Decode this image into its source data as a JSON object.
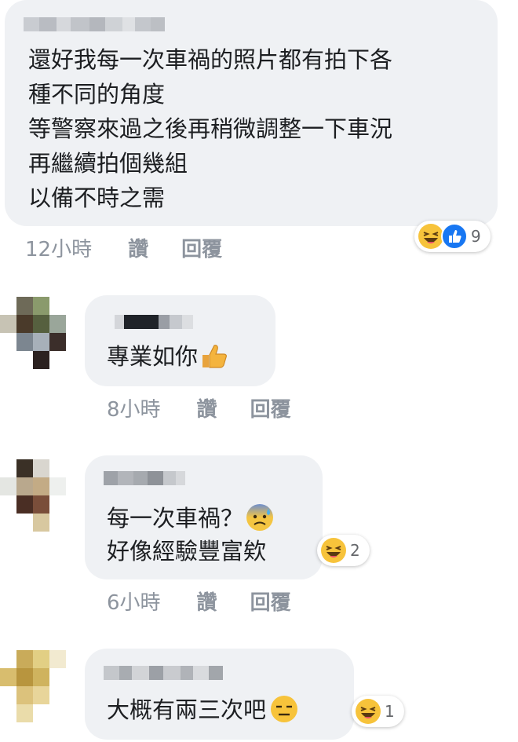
{
  "comments": [
    {
      "lines": [
        "還好我每一次車禍的照片都有拍下各",
        "種不同的角度",
        "等警察來過之後再稍微調整一下車況",
        "再繼續拍個幾組",
        "以備不時之需"
      ],
      "time": "12小時",
      "like_label": "讚",
      "reply_label": "回覆",
      "reactions": [
        "haha-icon",
        "like-icon"
      ],
      "reaction_count": "9"
    },
    {
      "lines": [
        "專業如你"
      ],
      "emoji": "thumbs-up-icon",
      "time": "8小時",
      "like_label": "讚",
      "reply_label": "回覆"
    },
    {
      "lines": [
        "每一次車禍？",
        "好像經驗豐富欸"
      ],
      "emoji": "anxious-sweat-face-icon",
      "time": "6小時",
      "like_label": "讚",
      "reply_label": "回覆",
      "reactions": [
        "haha-icon"
      ],
      "reaction_count": "2"
    },
    {
      "lines": [
        "大概有兩三次吧"
      ],
      "emoji": "expressionless-face-icon",
      "reactions": [
        "haha-icon"
      ],
      "reaction_count": "1"
    }
  ],
  "colors": {
    "bubble": "#eff1f4",
    "meta_text": "#8d949e",
    "like_blue": "#1877f2",
    "haha_yellow": "#f7c33b"
  }
}
